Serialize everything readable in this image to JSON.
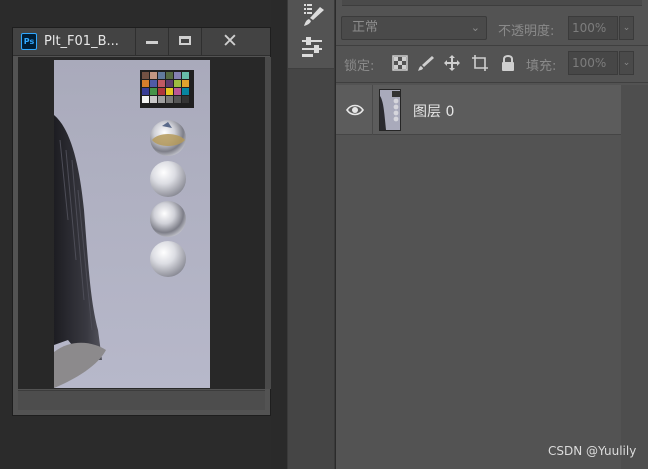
{
  "document_window": {
    "app_badge": "Ps",
    "title": "Plt_F01_B...",
    "minimize_icon": "minimize-icon",
    "maximize_icon": "maximize-icon",
    "close_glyph": "✕"
  },
  "toolbar": {
    "tools": [
      {
        "name": "brush-presets-icon"
      },
      {
        "name": "adjust-properties-icon"
      }
    ]
  },
  "layers_panel": {
    "blend_mode": "正常",
    "opacity_label": "不透明度:",
    "opacity_value": "100%",
    "lock_label": "锁定:",
    "fill_label": "填充:",
    "fill_value": "100%",
    "lock_icons": [
      "lock-transparent-pixels-icon",
      "lock-image-pixels-icon",
      "lock-position-icon",
      "lock-artboard-icon",
      "lock-all-icon"
    ],
    "layers": [
      {
        "name": "图层 0",
        "visible": true
      }
    ]
  },
  "watermark": "CSDN @Yuulily",
  "colors": {
    "panel_bg": "#535353",
    "dark_bg": "#2b2b2b",
    "document_bg": "#b0b1c2",
    "ps_accent": "#31a8ff"
  }
}
